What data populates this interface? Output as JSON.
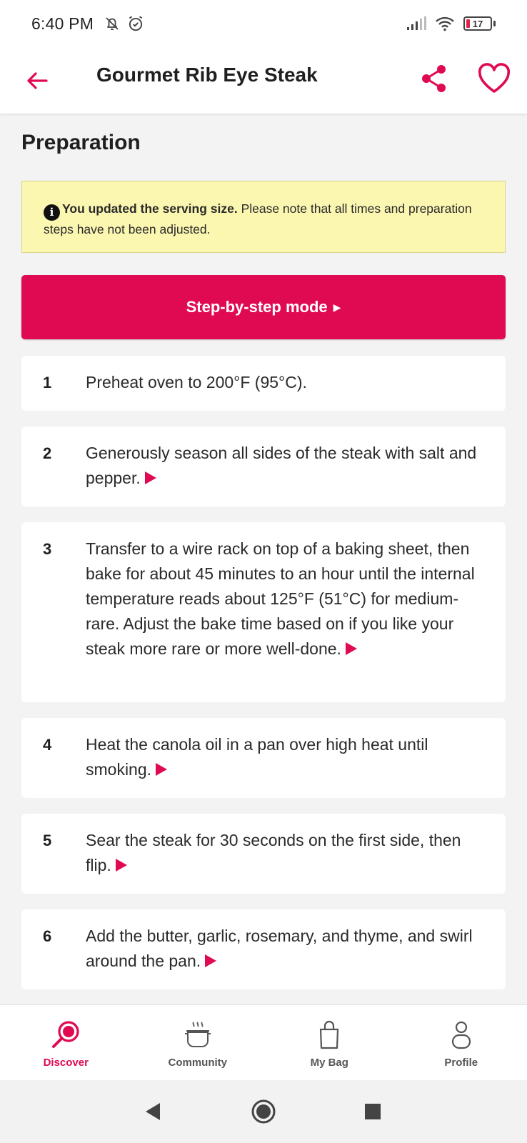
{
  "status_bar": {
    "time": "6:40 PM",
    "battery": "17"
  },
  "header": {
    "title": "Gourmet Rib Eye Steak"
  },
  "section": {
    "title": "Preparation"
  },
  "notice": {
    "bold": "You updated the serving size.",
    "text": " Please note that all times and preparation steps have not been adjusted."
  },
  "step_mode": {
    "label": "Step-by-step mode"
  },
  "steps": [
    {
      "num": "1",
      "text": "Preheat oven to 200°F (95°C).",
      "has_play": false
    },
    {
      "num": "2",
      "text": "Generously season all sides of the steak with salt and pepper.",
      "has_play": true
    },
    {
      "num": "3",
      "text": "Transfer to a wire rack on top of a baking sheet, then bake for about 45 minutes to an hour until the internal temperature reads about 125°F (51°C) for medium-rare. Adjust the bake time based on if you like your steak more rare or more well-done.",
      "has_play": true
    },
    {
      "num": "4",
      "text": "Heat the canola oil in a pan over high heat until smoking.",
      "has_play": true
    },
    {
      "num": "5",
      "text": "Sear the steak for 30 seconds on the first side, then flip.",
      "has_play": true
    },
    {
      "num": "6",
      "text": "Add the butter, garlic, rosemary, and thyme, and swirl around the pan.",
      "has_play": true
    }
  ],
  "bottom_nav": {
    "items": [
      {
        "label": "Discover",
        "icon": "pan-icon",
        "active": true
      },
      {
        "label": "Community",
        "icon": "pot-icon",
        "active": false
      },
      {
        "label": "My Bag",
        "icon": "bag-icon",
        "active": false
      },
      {
        "label": "Profile",
        "icon": "profile-icon",
        "active": false
      }
    ]
  },
  "colors": {
    "accent": "#e00a52",
    "notice_bg": "#fbf6b0",
    "page_bg": "#f3f3f3"
  }
}
